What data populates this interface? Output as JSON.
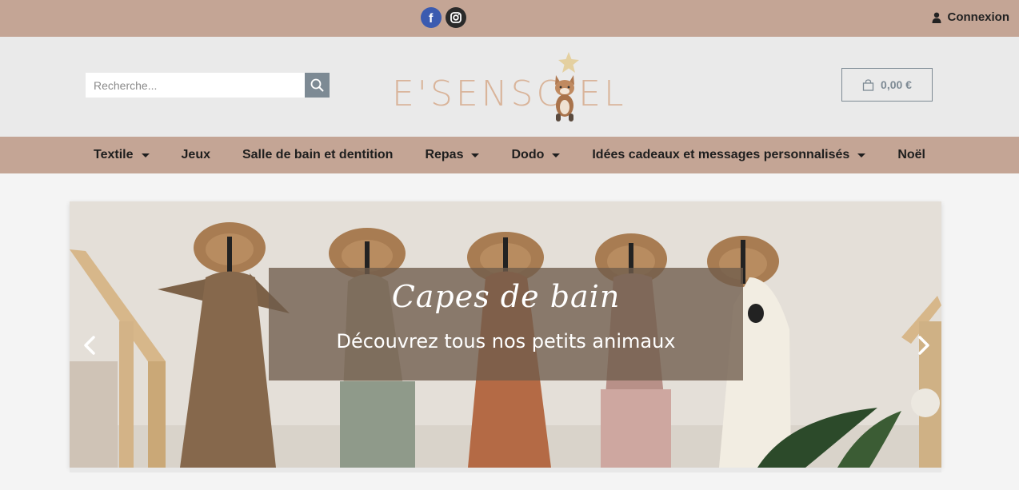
{
  "topbar": {
    "social": [
      {
        "icon": "facebook-icon"
      },
      {
        "icon": "instagram-icon"
      }
    ],
    "login_label": "Connexion"
  },
  "header": {
    "search_placeholder": "Recherche...",
    "logo_text": "E'SENSC  EL",
    "cart_total": "0,00 €"
  },
  "nav": {
    "items": [
      {
        "label": "Textile",
        "dropdown": true
      },
      {
        "label": "Jeux",
        "dropdown": false
      },
      {
        "label": "Salle de bain et dentition",
        "dropdown": false
      },
      {
        "label": "Repas",
        "dropdown": true
      },
      {
        "label": "Dodo",
        "dropdown": true
      },
      {
        "label": "Idées cadeaux et messages personnalisés",
        "dropdown": true
      },
      {
        "label": "Noël",
        "dropdown": false
      }
    ]
  },
  "slider": {
    "title": "Capes de bain",
    "subtitle": "Découvrez tous nos petits animaux"
  },
  "colors": {
    "topbar": "#c4a595",
    "header": "#eaeaea",
    "accent": "#7d8a94",
    "logo": "#d9b49a"
  }
}
